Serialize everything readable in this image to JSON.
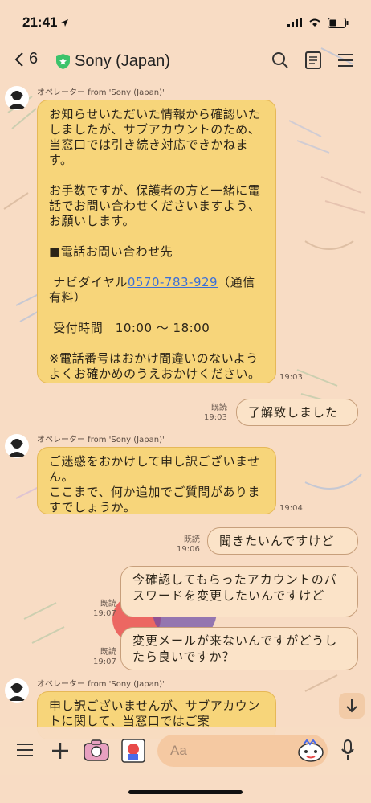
{
  "status": {
    "time": "21:41"
  },
  "header": {
    "back_count": "6",
    "title": "Sony (Japan)"
  },
  "operator_name": "オペレーター from 'Sony (Japan)'",
  "read_label": "既読",
  "messages": [
    {
      "id": "m1",
      "text_a": "お知らせいただいた情報から確認いたしましたが、サブアカウントのため、当窓口では引き続き対応できかねます。\n\nお手数ですが、保護者の方と一緒に電話でお問い合わせくださいますよう、お願いします。\n\n■電話お問い合わせ先\n\n ナビダイヤル",
      "link": "0570-783-929",
      "text_b": "（通信有料）\n\n 受付時間　10:00 〜 18:00\n\n※電話番号はおかけ間違いのないようよくお確かめのうえおかけください。",
      "time": "19:03"
    },
    {
      "id": "m2",
      "text": "了解致しました",
      "time": "19:03"
    },
    {
      "id": "m3",
      "text": "ご迷惑をおかけして申し訳ございません。\nここまで、何か追加でご質問がありますでしょうか。",
      "time": "19:04"
    },
    {
      "id": "m4",
      "text": "聞きたいんですけど",
      "time": "19:06"
    },
    {
      "id": "m5",
      "text": "今確認してもらったアカウントのパスワードを変更したいんですけど",
      "time": "19:07"
    },
    {
      "id": "m6",
      "text": "変更メールが来ないんですがどうしたら良いですか？",
      "time": "19:07"
    },
    {
      "id": "m7",
      "text": "申し訳ございませんが、サブアカウントに関して、当窓口ではご案"
    }
  ],
  "input": {
    "placeholder": "Aa"
  },
  "colors": {
    "background": "#f8dcc4",
    "incoming_bubble": "#f7d57a",
    "outgoing_bubble": "#fbe3c8",
    "link": "#3b6fd8",
    "verified_badge": "#3cc36b"
  },
  "icons": [
    "back-chevron-icon",
    "verified-badge-icon",
    "search-icon",
    "notes-icon",
    "menu-icon",
    "hamburger-icon",
    "plus-icon",
    "camera-icon",
    "image-icon",
    "emoji-icon",
    "microphone-icon",
    "arrow-down-icon"
  ]
}
